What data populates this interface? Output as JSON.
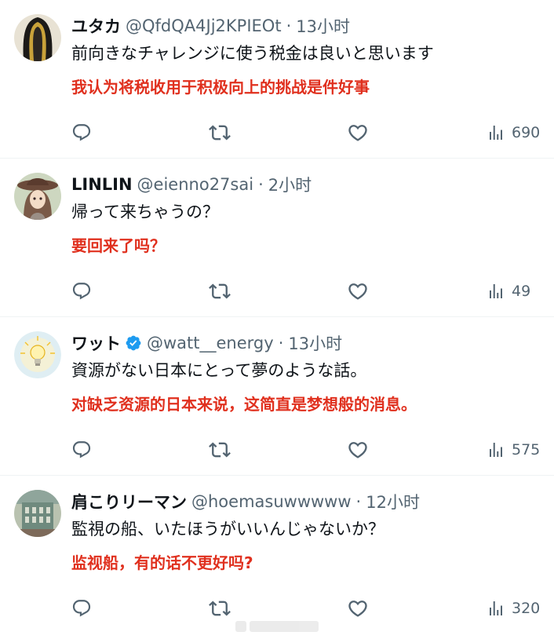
{
  "tweets": [
    {
      "name": "ユタカ",
      "verified": false,
      "handle": "@QfdQA4Jj2KPIEOt",
      "separator": "·",
      "time": "13小时",
      "text": "前向きなチャレンジに使う税金は良いと思います",
      "translation": "我认为将税收用于积极向上的挑战是件好事",
      "views": "690",
      "avatar_icon": "hooded-figure-avatar"
    },
    {
      "name": "LINLIN",
      "verified": false,
      "handle": "@eienno27sai",
      "separator": "·",
      "time": "2小时",
      "text": "帰って来ちゃうの？",
      "translation": "要回来了吗？",
      "views": "49",
      "avatar_icon": "anime-girl-hat-avatar"
    },
    {
      "name": "ワット",
      "verified": true,
      "handle": "@watt__energy",
      "separator": "·",
      "time": "13小时",
      "text": "資源がない日本にとって夢のような話。",
      "translation": "对缺乏资源的日本来说，这简直是梦想般的消息。",
      "views": "575",
      "avatar_icon": "lightbulb-avatar"
    },
    {
      "name": "肩こりリーマン",
      "verified": false,
      "handle": "@hoemasuwwwww",
      "separator": "·",
      "time": "12小时",
      "text": "監視の船、いたほうがいいんじゃないか？",
      "translation": "监视船，有的话不更好吗?",
      "views": "320",
      "avatar_icon": "building-photo-avatar"
    }
  ],
  "icons": {
    "reply": "reply-icon",
    "retweet": "retweet-icon",
    "like": "heart-icon",
    "views": "views-chart-icon",
    "verified": "verified-badge-icon"
  },
  "colors": {
    "translation": "#e0301e",
    "secondary_text": "#536471",
    "verified": "#1d9bf0",
    "divider": "#eff3f4"
  }
}
